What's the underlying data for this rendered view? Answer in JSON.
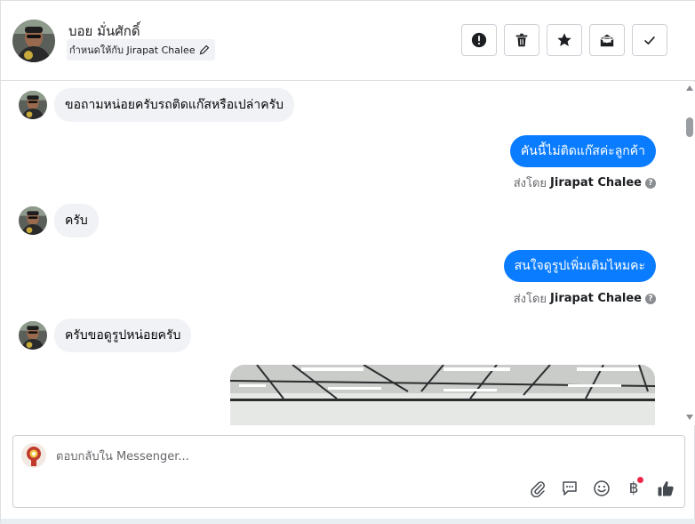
{
  "header": {
    "contact_name": "บอย มั่นศักดิ์",
    "assigned_label": "กำหนดให้กับ Jirapat Chalee",
    "actions": [
      {
        "name": "mark-spam-button",
        "icon": "alert-circle-icon"
      },
      {
        "name": "delete-button",
        "icon": "trash-icon"
      },
      {
        "name": "star-button",
        "icon": "star-icon"
      },
      {
        "name": "mark-unread-button",
        "icon": "envelope-open-icon"
      },
      {
        "name": "mark-done-button",
        "icon": "check-icon"
      }
    ]
  },
  "thread": {
    "messages": [
      {
        "direction": "in",
        "text": "ขอถามหน่อยครับรถติดแก๊สหรือเปล่าครับ"
      },
      {
        "direction": "out",
        "text": "คันนี้ไม่ติดแก๊สค่ะลูกค้า",
        "sent_by_prefix": "ส่งโดย",
        "sent_by_name": "Jirapat Chalee"
      },
      {
        "direction": "in",
        "text": "ครับ"
      },
      {
        "direction": "out",
        "text": "สนใจดูรูปเพิ่มเติมไหมคะ",
        "sent_by_prefix": "ส่งโดย",
        "sent_by_name": "Jirapat Chalee"
      },
      {
        "direction": "in",
        "text": "ครับขอดูรูปหน่อยครับ"
      }
    ]
  },
  "composer": {
    "placeholder": "ตอบกลับใน Messenger...",
    "value": "",
    "tools": [
      "attach-icon",
      "saved-reply-icon",
      "emoji-icon",
      "payment-icon",
      "like-icon"
    ],
    "payment_symbol": "฿"
  },
  "colors": {
    "accent": "#0a7cff",
    "incoming_bubble": "#f0f2f5",
    "notification_dot": "#f02849"
  }
}
